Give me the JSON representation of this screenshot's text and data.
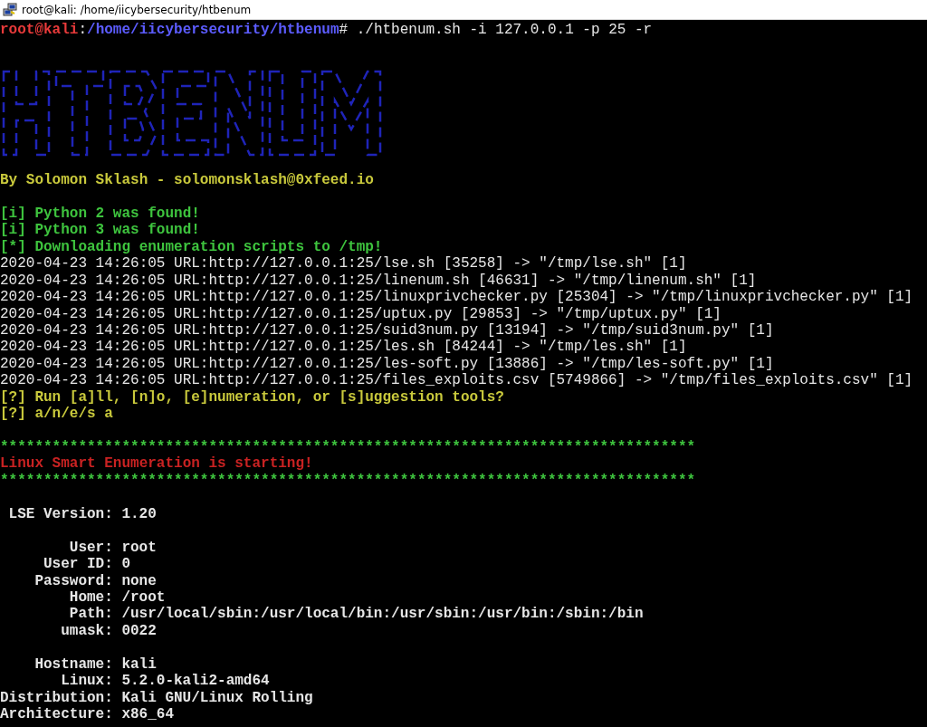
{
  "window": {
    "title": "root@kali: /home/iicybersecurity/htbenum"
  },
  "lines": [
    {
      "kind": "prompt",
      "user": "root@kali",
      "separator": ":",
      "path": "/home/iicybersecurity/htbenum",
      "command": "# ./htbenum.sh -i 127.0.0.1 -p 25 -r"
    },
    {
      "kind": "banner"
    },
    {
      "kind": "credit",
      "text": "By Solomon Sklash - solomonsklash@0xfeed.io"
    },
    {
      "kind": "blank"
    },
    {
      "kind": "info",
      "text": "[i] Python 2 was found!"
    },
    {
      "kind": "info",
      "text": "[i] Python 3 was found!"
    },
    {
      "kind": "info",
      "text": "[*] Downloading enumeration scripts to /tmp!"
    },
    {
      "kind": "log",
      "text": "2020-04-23 14:26:05 URL:http://127.0.0.1:25/lse.sh [35258] -> \"/tmp/lse.sh\" [1]"
    },
    {
      "kind": "log",
      "text": "2020-04-23 14:26:05 URL:http://127.0.0.1:25/linenum.sh [46631] -> \"/tmp/linenum.sh\" [1]"
    },
    {
      "kind": "log",
      "text": "2020-04-23 14:26:05 URL:http://127.0.0.1:25/linuxprivchecker.py [25304] -> \"/tmp/linuxprivchecker.py\" [1]"
    },
    {
      "kind": "log",
      "text": "2020-04-23 14:26:05 URL:http://127.0.0.1:25/uptux.py [29853] -> \"/tmp/uptux.py\" [1]"
    },
    {
      "kind": "log",
      "text": "2020-04-23 14:26:05 URL:http://127.0.0.1:25/suid3num.py [13194] -> \"/tmp/suid3num.py\" [1]"
    },
    {
      "kind": "log",
      "text": "2020-04-23 14:26:05 URL:http://127.0.0.1:25/les.sh [84244] -> \"/tmp/les.sh\" [1]"
    },
    {
      "kind": "log",
      "text": "2020-04-23 14:26:05 URL:http://127.0.0.1:25/les-soft.py [13886] -> \"/tmp/les-soft.py\" [1]"
    },
    {
      "kind": "log",
      "text": "2020-04-23 14:26:05 URL:http://127.0.0.1:25/files_exploits.csv [5749866] -> \"/tmp/files_exploits.csv\" [1]"
    },
    {
      "kind": "question",
      "text": "[?] Run [a]ll, [n]o, [e]numeration, or [s]uggestion tools?"
    },
    {
      "kind": "question",
      "text": "[?] a/n/e/s a"
    },
    {
      "kind": "blank"
    },
    {
      "kind": "rule",
      "text": "********************************************************************************"
    },
    {
      "kind": "heading",
      "text": "Linux Smart Enumeration is starting!"
    },
    {
      "kind": "rule",
      "text": "********************************************************************************"
    },
    {
      "kind": "blank"
    },
    {
      "kind": "field",
      "label": "LSE Version:",
      "value": "1.20"
    },
    {
      "kind": "blank"
    },
    {
      "kind": "field",
      "label": "User:",
      "value": "root"
    },
    {
      "kind": "field",
      "label": "User ID:",
      "value": "0"
    },
    {
      "kind": "field",
      "label": "Password:",
      "value": "none"
    },
    {
      "kind": "field",
      "label": "Home:",
      "value": "/root"
    },
    {
      "kind": "field",
      "label": "Path:",
      "value": "/usr/local/sbin:/usr/local/bin:/usr/sbin:/usr/bin:/sbin:/bin"
    },
    {
      "kind": "field",
      "label": "umask:",
      "value": "0022"
    },
    {
      "kind": "blank"
    },
    {
      "kind": "field",
      "label": "Hostname:",
      "value": "kali"
    },
    {
      "kind": "field",
      "label": "Linux:",
      "value": "5.2.0-kali2-amd64"
    },
    {
      "kind": "field",
      "label": "Distribution:",
      "value": "Kali GNU/Linux Rolling"
    },
    {
      "kind": "field",
      "label": "Architecture:",
      "value": "x86_64"
    }
  ]
}
